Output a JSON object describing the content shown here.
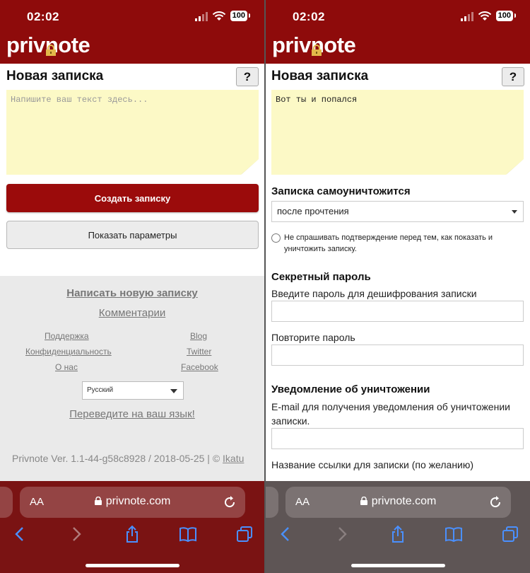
{
  "status_bar": {
    "time": "02:02",
    "battery": "100"
  },
  "brand": {
    "logo": "privnote"
  },
  "left": {
    "title": "Новая записка",
    "help_label": "?",
    "note_placeholder": "Напишите ваш текст здесь...",
    "create_button": "Создать записку",
    "options_button": "Показать параметры",
    "footer": {
      "new_note": "Написать новую записку",
      "comments": "Комментарии",
      "links": [
        {
          "label": "Поддержка"
        },
        {
          "label": "Blog"
        },
        {
          "label": "Конфиденциальность"
        },
        {
          "label": "Twitter"
        },
        {
          "label": "О нас"
        },
        {
          "label": "Facebook"
        }
      ],
      "language": "Русский",
      "translate": "Переведите на ваш язык!",
      "version": "Privnote Ver. 1.1-44-g58c8928 / 2018-05-25 | ©",
      "version_link": "Ikatu"
    }
  },
  "right": {
    "title": "Новая записка",
    "help_label": "?",
    "note_text": "Вот ты и попался",
    "destruct_label": "Записка самоуничтожится",
    "destruct_value": "после прочтения",
    "no_confirm_label": "Не спрашивать подтверждение перед тем, как показать и уничтожить записку.",
    "password_heading": "Секретный пароль",
    "password_label": "Введите пароль для дешифрования записки",
    "password_repeat_label": "Повторите пароль",
    "notify_heading": "Уведомление об уничтожении",
    "email_label": "E-mail для получения уведомления об уничтожении записки.",
    "link_name_label": "Название ссылки для записки (по желанию)"
  },
  "safari": {
    "aa": "AA",
    "url": "privnote.com"
  },
  "colors": {
    "brand": "#8e0b0b",
    "note_bg": "#fcf9c6",
    "button": "#9b0b0b"
  }
}
